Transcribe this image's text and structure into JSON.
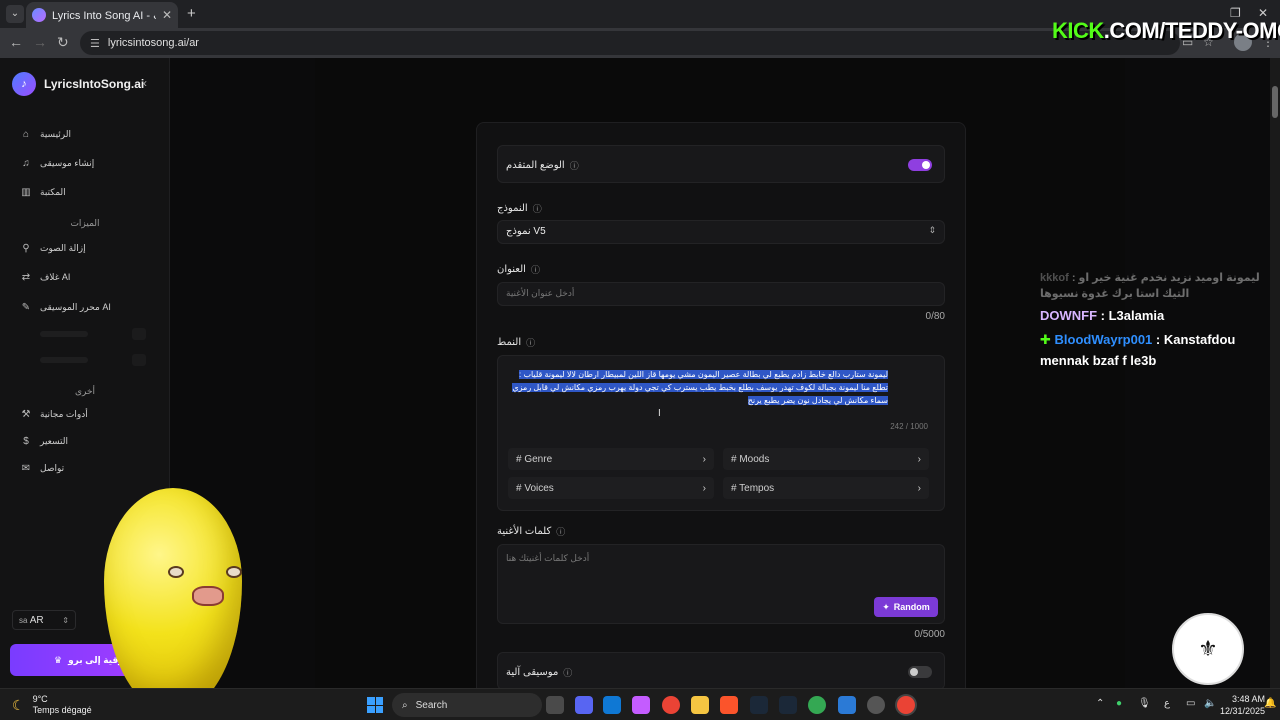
{
  "browser": {
    "tab_title": "Lyrics Into Song AI - مولد أغاني بالذكاء الاصطناعي عبر الإنترنت",
    "url": "lyricsintosong.ai/ar",
    "overlay_text_kick": "KICK",
    "overlay_text_channel": ".COM/TEDDY-OMG"
  },
  "sidebar": {
    "brand": "LyricsIntoSong.ai",
    "logo_text": "♪",
    "items_top": [
      {
        "label": "الرئيسية",
        "icon": "home-icon"
      },
      {
        "label": "إنشاء موسيقى",
        "icon": "music-icon"
      },
      {
        "label": "المكتبة",
        "icon": "library-icon"
      }
    ],
    "section_tools": "الميزات",
    "items_tools": [
      {
        "label": "إزالة الصوت",
        "icon": "voice-remove-icon"
      },
      {
        "label": "غلاف AI",
        "icon": "cover-icon"
      },
      {
        "label": "محرر الموسيقى AI",
        "icon": "editor-icon"
      }
    ],
    "section_other": "أخرى",
    "items_other": [
      {
        "label": "أدوات مجانية",
        "icon": "tools-icon"
      },
      {
        "label": "التسعير",
        "icon": "dollar-icon"
      },
      {
        "label": "تواصل",
        "icon": "mail-icon"
      }
    ],
    "language": "AR",
    "language_flag": "sa",
    "upgrade_label": "الترقية إلى برو"
  },
  "form": {
    "advanced_mode_label": "الوضع المتقدم",
    "advanced_mode_on": true,
    "model_label": "النموذج",
    "model_value": "نموذج V5",
    "title_label": "العنوان",
    "title_placeholder": "أدخل عنوان الأغنية",
    "title_count": "0/80",
    "style_label": "النمط",
    "style_text": "ليمونة ستارب دالع خابط زادم يطبع لي بطالة عصير اليمون مشي يومها قاز اللين لمبيطار ارطان لالا ليمونة قلياب : تطلع منا ليمونة بجبالة لكوف تهدر يوسف بطلع بخبط يطب يسترب كي تجي دولة يهرب رمزي مكانش لي قابل رمزي سماء مكانش لي يجادل نون يضر يطبع يرنح",
    "style_count": "242 / 1000",
    "chips": [
      "# Genre",
      "# Moods",
      "# Voices",
      "# Tempos"
    ],
    "lyrics_label": "كلمات الأغنية",
    "lyrics_placeholder": "أدخل كلمات أغنيتك هنا",
    "random_label": "Random",
    "lyrics_count": "0/5000",
    "instrumental_label": "موسيقى آلية",
    "instrumental_on": false
  },
  "chat": {
    "msg1_user": "kkkof",
    "msg1_text": "ليمونة اوميد نزيد نخدم غنية خير او : التيك استا برك غدوة نسيوها",
    "msg2_user": "DOWNFF",
    "msg2_text": ": L3alamia",
    "msg3_user": "BloodWayrp001",
    "msg3_text": ": Kanstafdou mennak bzaf f le3b"
  },
  "taskbar": {
    "temperature": "9°C",
    "weather": "Temps dégagé",
    "search_label": "Search",
    "time": "3:48 AM",
    "date": "12/31/2025",
    "input_lang": "ع"
  },
  "colors": {
    "accent": "#7b3ad6",
    "toggle_on": "#8f3fe0",
    "selection": "#2f57c6",
    "kick_green": "#53fc18"
  }
}
